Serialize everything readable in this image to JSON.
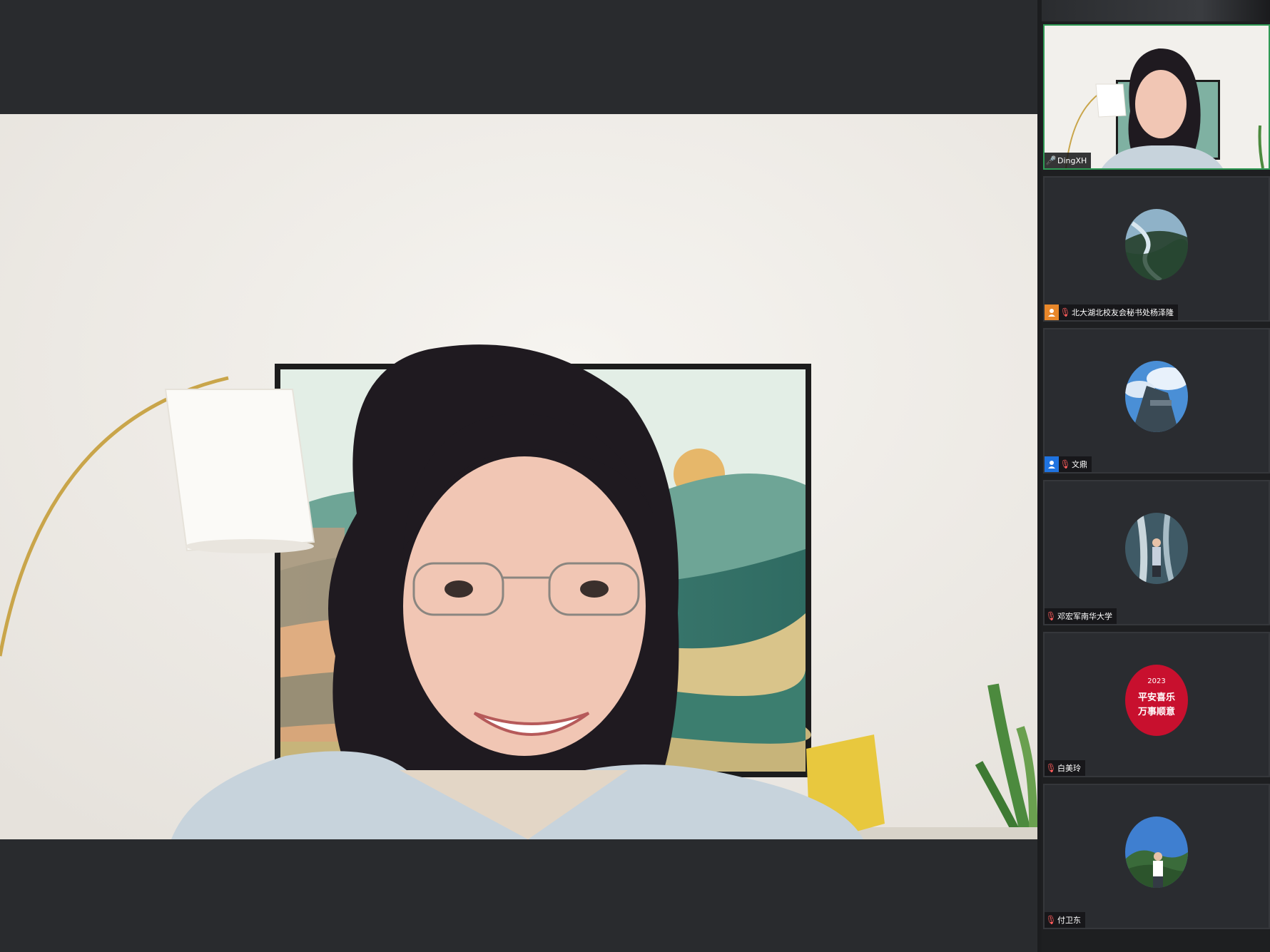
{
  "main_speaker": {
    "name": "DingXH",
    "mic": "on"
  },
  "participants": [
    {
      "name": "DingXH",
      "mic": "on",
      "badge": "",
      "active": true
    },
    {
      "name": "北大湖北校友会秘书处杨泽隆",
      "mic": "muted",
      "badge": "host",
      "active": false
    },
    {
      "name": "文鼎",
      "mic": "muted",
      "badge": "co-host",
      "active": false
    },
    {
      "name": "邓宏军南华大学",
      "mic": "muted",
      "badge": "",
      "active": false
    },
    {
      "name": "白美玲",
      "mic": "muted",
      "badge": "",
      "active": false
    },
    {
      "name": "付卫东",
      "mic": "muted",
      "badge": "",
      "active": false
    }
  ],
  "avatar_text": {
    "year": "2023",
    "line1": "平安喜乐",
    "line2": "万事顺意"
  },
  "colors": {
    "active_border": "#2f9a55",
    "host_badge": "#e8872a",
    "cohost_badge": "#1f73e0",
    "muted_mic": "#ff5c5c",
    "live_mic": "#47d36a",
    "avatar_red": "#c8102e"
  }
}
